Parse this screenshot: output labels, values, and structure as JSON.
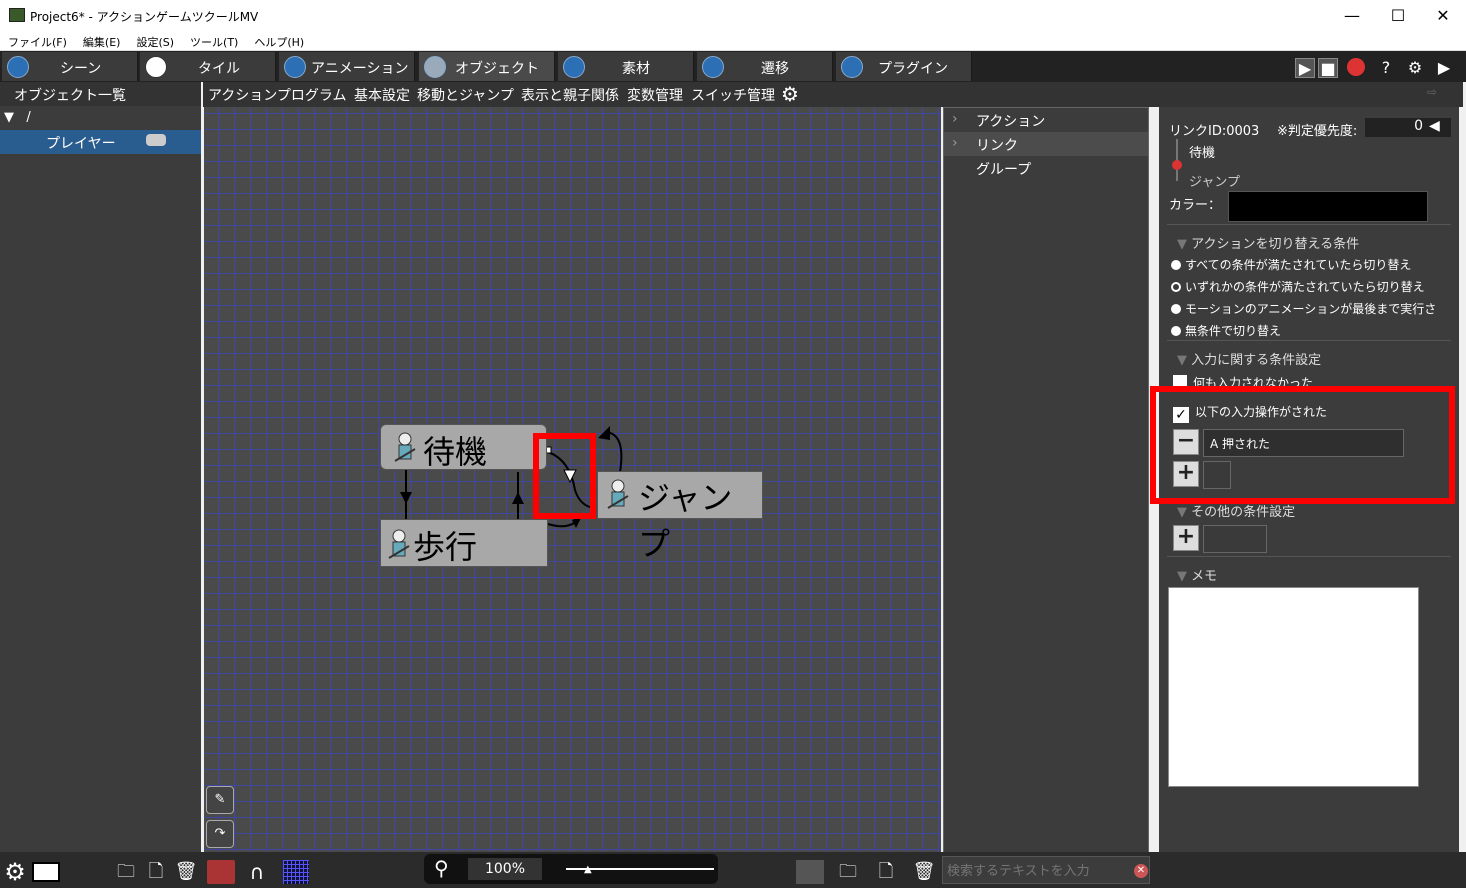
{
  "window": {
    "title": "Project6* - アクションゲームツクールMV",
    "minimize": "—",
    "maximize": "☐",
    "close": "✕"
  },
  "menu": [
    "ファイル(F)",
    "編集(E)",
    "設定(S)",
    "ツール(T)",
    "ヘルプ(H)"
  ],
  "main_tabs": [
    "シーン",
    "タイル",
    "アニメーション",
    "オブジェクト",
    "素材",
    "遷移",
    "プラグイン"
  ],
  "object_list": {
    "header": "オブジェクト一覧",
    "root": "/",
    "item": "プレイヤー"
  },
  "sub_tabs": [
    "アクションプログラム",
    "基本設定",
    "移動とジャンプ",
    "表示と親子関係",
    "変数管理",
    "スイッチ管理"
  ],
  "nodes": {
    "wait": "待機",
    "walk": "歩行",
    "jump": "ジャンプ"
  },
  "list_items": [
    "アクション",
    "リンク",
    "グループ"
  ],
  "properties": {
    "link_id": "リンクID:0003",
    "priority_label": "※判定優先度:",
    "priority_value": "0",
    "from": "待機",
    "to": "ジャンプ",
    "color_label": "カラー：",
    "switch_section": "アクションを切り替える条件",
    "opt1": "すべての条件が満たされていたら切り替え",
    "opt2": "いずれかの条件が満たされていたら切り替え",
    "opt3": "モーションのアニメーションが最後まで実行さ",
    "opt4": "無条件で切り替え",
    "input_section": "入力に関する条件設定",
    "no_input": "何も入力されなかった",
    "input_done": "以下の入力操作がされた",
    "input_entry": "A 押された",
    "other_section": "その他の条件設定",
    "memo_section": "メモ"
  },
  "bottom": {
    "zoom": "100%",
    "search_placeholder": "検索するテキストを入力"
  },
  "colors": {
    "highlight": "#ff0000",
    "grid": "#3f48a0",
    "selection": "#2a5d8f"
  }
}
